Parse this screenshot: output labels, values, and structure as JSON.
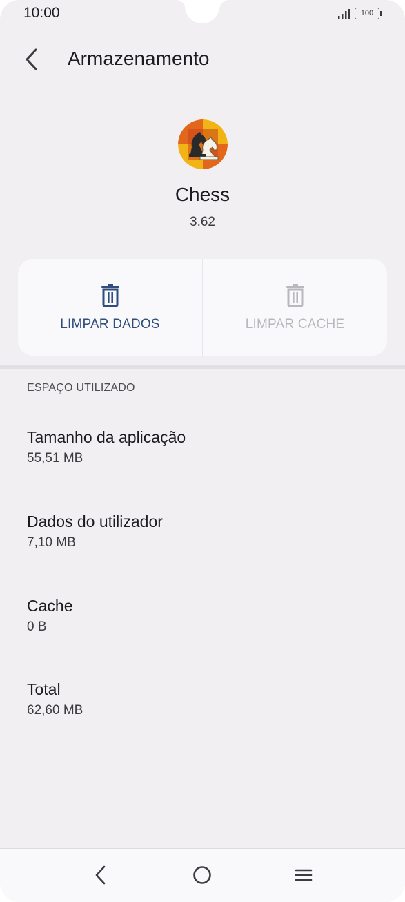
{
  "status_bar": {
    "time": "10:00",
    "battery": "100",
    "icons": [
      "signal-icon",
      "battery-icon"
    ]
  },
  "app_bar": {
    "title": "Armazenamento",
    "back_icon": "chevron-left-icon"
  },
  "app_info": {
    "name": "Chess",
    "version": "3.62",
    "icon": "chess-app-icon"
  },
  "actions": {
    "clear_data": {
      "label": "LIMPAR DADOS",
      "icon": "trash-icon",
      "enabled": true
    },
    "clear_cache": {
      "label": "LIMPAR CACHE",
      "icon": "trash-icon",
      "enabled": false
    }
  },
  "storage": {
    "header": "ESPAÇO UTILIZADO",
    "rows": [
      {
        "title": "Tamanho da aplicação",
        "value": "55,51 MB"
      },
      {
        "title": "Dados do utilizador",
        "value": "7,10 MB"
      },
      {
        "title": "Cache",
        "value": "0 B"
      },
      {
        "title": "Total",
        "value": "62,60 MB"
      }
    ]
  },
  "nav_bar": {
    "icons": [
      "nav-back-icon",
      "nav-home-icon",
      "nav-menu-icon"
    ]
  },
  "colors": {
    "background": "#f1eff2",
    "card": "#f9f8fa",
    "accent": "#2f4d7d",
    "disabled": "#b8b8bd"
  }
}
